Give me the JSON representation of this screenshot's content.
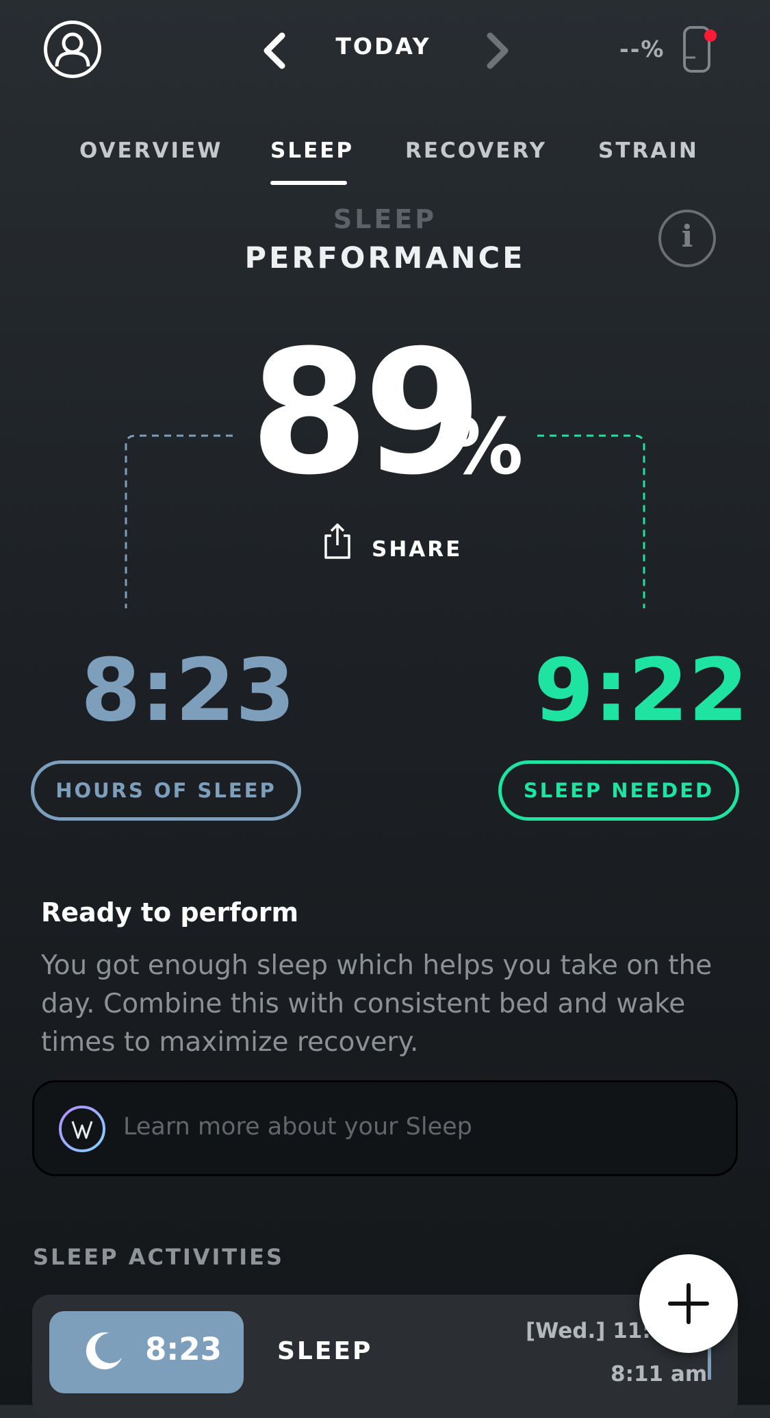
{
  "header": {
    "date_label": "TODAY",
    "battery_text": "--%",
    "colors": {
      "strap_dot": "#ff1a35"
    }
  },
  "tabs": [
    {
      "label": "OVERVIEW",
      "active": false
    },
    {
      "label": "SLEEP",
      "active": true
    },
    {
      "label": "RECOVERY",
      "active": false
    },
    {
      "label": "STRAIN",
      "active": false
    }
  ],
  "performance": {
    "title_faded": "SLEEP",
    "title": "PERFORMANCE",
    "info_glyph": "i",
    "score": "89",
    "score_unit": "%",
    "share_label": "SHARE"
  },
  "hours_of_sleep": {
    "value": "8:23",
    "label": "HOURS OF SLEEP",
    "color": "#7e9fbc"
  },
  "sleep_needed": {
    "value": "9:22",
    "label": "SLEEP NEEDED",
    "color": "#1fe3a0"
  },
  "insight": {
    "title": "Ready to perform",
    "body": "You got enough sleep which helps you take on the day. Combine this with consistent bed and wake times to maximize recovery.",
    "learn_more": "Learn more about your Sleep"
  },
  "activities": {
    "heading": "SLEEP ACTIVITIES",
    "items": [
      {
        "duration": "8:23",
        "label": "SLEEP",
        "start": "[Wed.] 11:05",
        "end": "8:11 am"
      }
    ]
  }
}
